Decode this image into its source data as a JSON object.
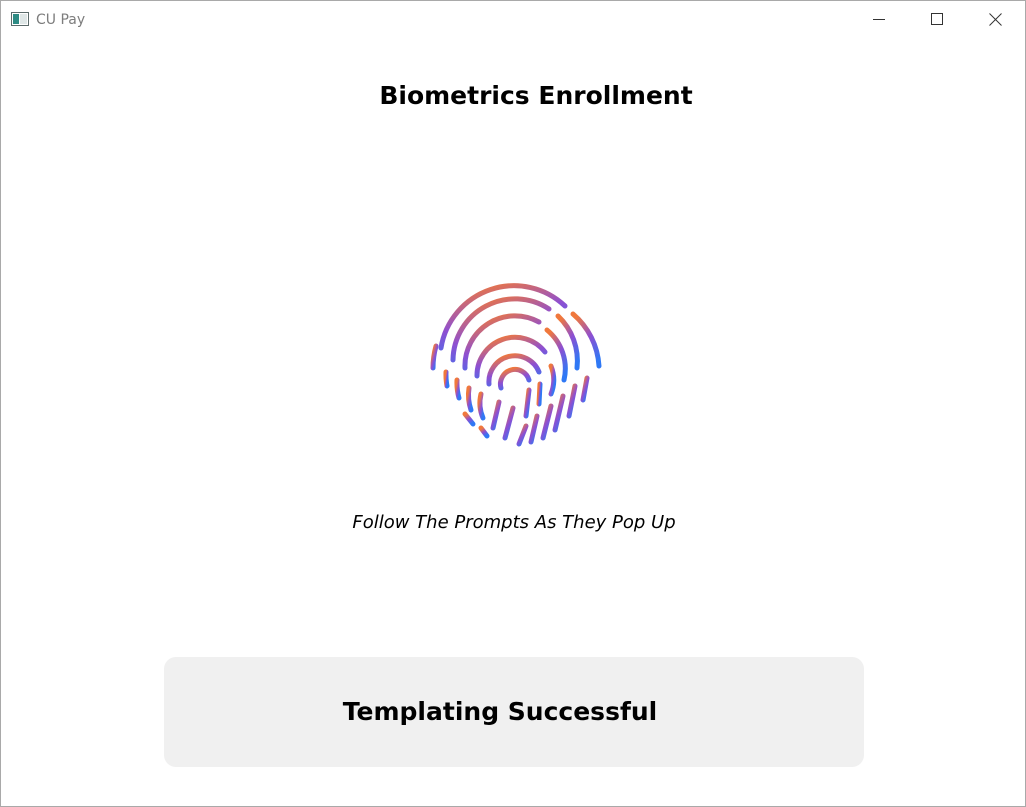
{
  "window": {
    "title": "CU Pay",
    "icon": "app-window-icon",
    "controls": {
      "minimize_icon": "minimize-icon",
      "maximize_icon": "maximize-icon",
      "close_icon": "close-icon"
    }
  },
  "main": {
    "heading": "Biometrics Enrollment",
    "fingerprint_icon": "fingerprint-icon",
    "prompt": "Follow The Prompts As They Pop Up",
    "status": "Templating Successful"
  },
  "colors": {
    "fingerprint_gradient_top": "#f0783c",
    "fingerprint_gradient_middle": "#8e4fd1",
    "fingerprint_gradient_bottom": "#2f78f5",
    "status_panel_background": "#f0f0f0"
  }
}
